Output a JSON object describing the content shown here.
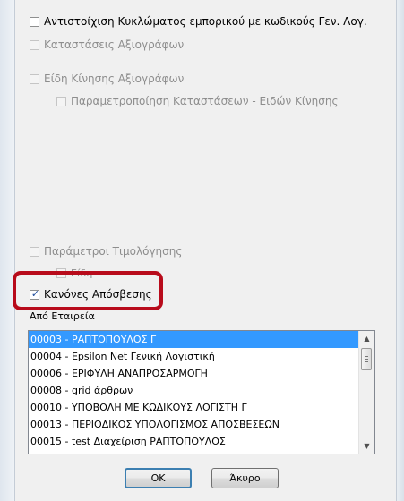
{
  "options": {
    "match_circuit": "Αντιστοίχιση Κυκλώματος εμπορικού με κωδικούς Γεν. Λογ.",
    "security_states": "Καταστάσεις Αξιογράφων",
    "movement_types": "Είδη Κίνησης Αξιογράφων",
    "parametrization": "Παραμετροποίηση Καταστάσεων - Ειδών Κίνησης",
    "billing_params": "Παράμετροι Τιμολόγησης",
    "items_partial": "Είδη",
    "depreciation_rules": "Κανόνες Απόσβεσης"
  },
  "from_company_label": "Από Εταιρεία",
  "company_list": [
    "00003 - ΡΑΠΤΟΠΟΥΛΟΣ Γ",
    "00004 - Epsilon Net Γενική Λογιστική",
    "00006 - ΕΡΙΦΥΛΗ ΑΝΑΠΡΟΣΑΡΜΟΓΗ",
    "00008 - grid άρθρων",
    "00010 - ΥΠΟΒΟΛΗ ΜΕ ΚΩΔΙΚΟΥΣ ΛΟΓΙΣΤΗ Γ",
    "00013 - ΠΕΡΙΟΔΙΚΟΣ ΥΠΟΛΟΓΙΣΜΟΣ ΑΠΟΣΒΕΣΕΩΝ",
    "00015 - test Διαχείριση ΡΑΠΤΟΠΟΥΛΟΣ"
  ],
  "buttons": {
    "ok": "OK",
    "cancel": "Άκυρο"
  },
  "icons": {
    "check": "✓",
    "scroll_up": "▲",
    "scroll_down": "▼"
  },
  "colors": {
    "selection": "#3399ff",
    "annotation": "#b80b1b"
  }
}
